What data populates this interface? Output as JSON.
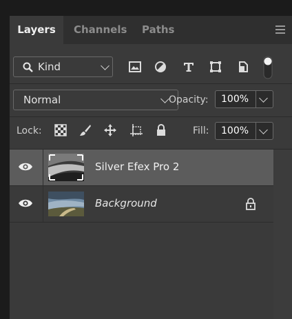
{
  "tabs": [
    {
      "label": "Layers",
      "active": true
    },
    {
      "label": "Channels",
      "active": false
    },
    {
      "label": "Paths",
      "active": false
    }
  ],
  "filter": {
    "kind_label": "Kind",
    "icons": [
      "image-filter-icon",
      "adjustment-filter-icon",
      "type-filter-icon",
      "shape-filter-icon",
      "smart-object-filter-icon",
      "filter-toggle-icon"
    ]
  },
  "blend": {
    "mode": "Normal",
    "opacity_label": "Opacity:",
    "opacity_value": "100%"
  },
  "lock": {
    "label": "Lock:",
    "icons": [
      "lock-transparent-pixels-icon",
      "lock-image-pixels-icon",
      "lock-position-icon",
      "lock-artboard-icon",
      "lock-all-icon"
    ],
    "fill_label": "Fill:",
    "fill_value": "100%"
  },
  "layers": [
    {
      "name": "Silver Efex Pro 2",
      "selected": true,
      "italic": false,
      "locked": false
    },
    {
      "name": "Background",
      "selected": false,
      "italic": true,
      "locked": true
    }
  ],
  "colors": {
    "panel_bg": "#3a3a3a",
    "tabbar_bg": "#2f2f2f",
    "selected_layer": "#5c5c5c",
    "text": "#dcdcdc"
  }
}
